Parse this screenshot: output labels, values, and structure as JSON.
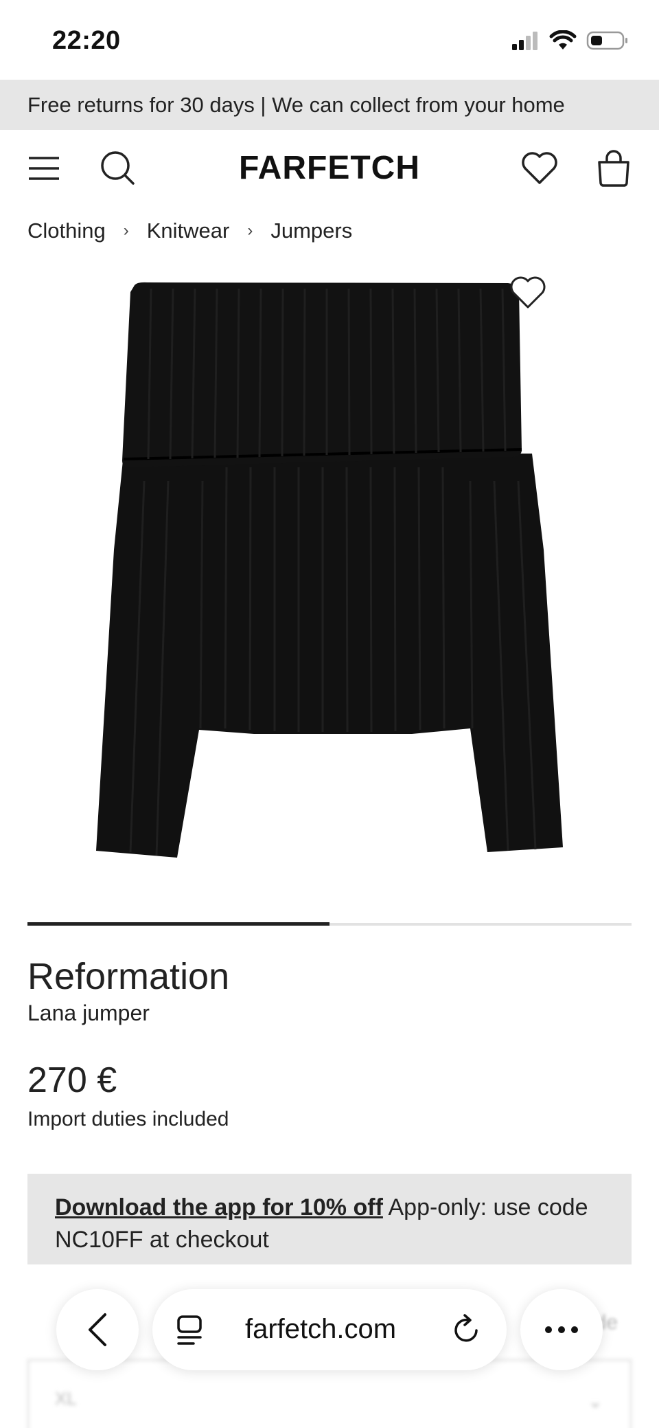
{
  "status_bar": {
    "time": "22:20"
  },
  "promo_banner": {
    "text": "Free returns for 30 days | We can collect from your home"
  },
  "header": {
    "logo": "FARFETCH"
  },
  "breadcrumb": {
    "items": [
      "Clothing",
      "Knitwear",
      "Jumpers"
    ],
    "separator": "›"
  },
  "gallery": {
    "progress": 0.5
  },
  "product": {
    "brand": "Reformation",
    "name": "Lana jumper",
    "price": "270 €",
    "duties": "Import duties included"
  },
  "app_promo": {
    "link_text": "Download the app for 10% off",
    "body_text": " App-only: use code NC10FF at checkout"
  },
  "size_select": {
    "value": "XL",
    "guide_label": "ide"
  },
  "browser": {
    "url": "farfetch.com"
  },
  "colors": {
    "banner_bg": "#e6e6e6",
    "text": "#222222",
    "product": "#111111"
  }
}
